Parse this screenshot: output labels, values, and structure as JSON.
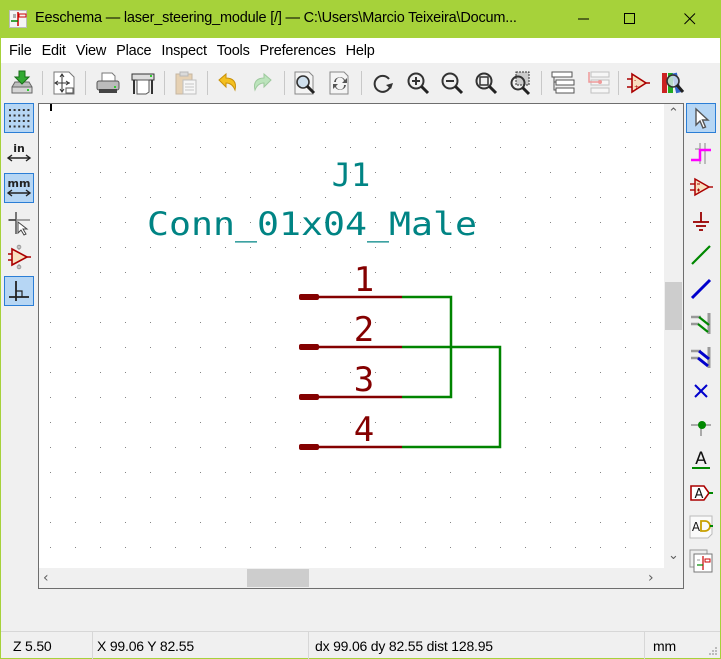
{
  "window": {
    "title": "Eeschema — laser_steering_module [/] — C:\\Users\\Marcio Teixeira\\Docum...",
    "controls": [
      "minimize",
      "maximize",
      "close"
    ],
    "accent_color": "#a6d23a"
  },
  "menu": {
    "items": [
      {
        "label": "File"
      },
      {
        "label": "Edit"
      },
      {
        "label": "View"
      },
      {
        "label": "Place"
      },
      {
        "label": "Inspect"
      },
      {
        "label": "Tools"
      },
      {
        "label": "Preferences"
      },
      {
        "label": "Help"
      }
    ]
  },
  "toolbar": {
    "items": [
      {
        "name": "save-icon",
        "tooltip": "Save"
      },
      {
        "name": "page-settings-icon",
        "tooltip": "Page settings"
      },
      {
        "name": "print-icon",
        "tooltip": "Print"
      },
      {
        "name": "plot-icon",
        "tooltip": "Plot"
      },
      {
        "name": "paste-icon",
        "tooltip": "Paste",
        "disabled": true
      },
      {
        "name": "undo-icon",
        "tooltip": "Undo"
      },
      {
        "name": "redo-icon",
        "tooltip": "Redo",
        "disabled": true
      },
      {
        "name": "find-icon",
        "tooltip": "Find"
      },
      {
        "name": "find-replace-icon",
        "tooltip": "Find and replace"
      },
      {
        "name": "redraw-icon",
        "tooltip": "Refresh"
      },
      {
        "name": "zoom-in-icon",
        "tooltip": "Zoom in"
      },
      {
        "name": "zoom-out-icon",
        "tooltip": "Zoom out"
      },
      {
        "name": "zoom-fit-icon",
        "tooltip": "Zoom to fit"
      },
      {
        "name": "zoom-selection-icon",
        "tooltip": "Zoom to selection"
      },
      {
        "name": "hierarchy-navigator-icon",
        "tooltip": "Hierarchy navigator"
      },
      {
        "name": "leave-sheet-icon",
        "tooltip": "Leave sheet",
        "disabled": true
      },
      {
        "name": "symbol-editor-icon",
        "tooltip": "Symbol editor"
      },
      {
        "name": "symbol-browser-icon",
        "tooltip": "Symbol library browser"
      }
    ]
  },
  "left_toolbar": {
    "items": [
      {
        "name": "grid-toggle-icon",
        "active": true
      },
      {
        "name": "units-inch-icon",
        "label": "in",
        "active": false
      },
      {
        "name": "units-mm-icon",
        "label": "mm",
        "active": true
      },
      {
        "name": "full-crosshair-icon",
        "active": false
      },
      {
        "name": "hidden-pins-icon",
        "active": false
      },
      {
        "name": "orthogonal-wire-icon",
        "active": true
      }
    ]
  },
  "right_toolbar": {
    "items": [
      {
        "name": "select-tool-icon",
        "active": true
      },
      {
        "name": "highlight-net-icon"
      },
      {
        "name": "add-symbol-icon"
      },
      {
        "name": "add-power-icon"
      },
      {
        "name": "add-wire-icon"
      },
      {
        "name": "add-bus-icon"
      },
      {
        "name": "add-wire-to-bus-entry-icon"
      },
      {
        "name": "add-bus-to-bus-entry-icon"
      },
      {
        "name": "add-no-connect-icon"
      },
      {
        "name": "add-junction-icon"
      },
      {
        "name": "add-label-icon",
        "label": "A"
      },
      {
        "name": "add-global-label-icon",
        "label": "A"
      },
      {
        "name": "add-hierarchical-label-icon",
        "label": "A"
      },
      {
        "name": "add-sheet-icon"
      }
    ]
  },
  "schematic": {
    "colors": {
      "reference": "#008484",
      "pin": "#840000",
      "wire": "#008400",
      "grid": "#848484"
    },
    "symbol": {
      "reference": "J1",
      "value": "Conn_01x04_Male",
      "pins": [
        {
          "number": "1"
        },
        {
          "number": "2"
        },
        {
          "number": "3"
        },
        {
          "number": "4"
        }
      ]
    },
    "wires": [
      {
        "from_pin": "1",
        "to_pin": "3"
      },
      {
        "from_pin": "2",
        "to_pin": "4"
      }
    ]
  },
  "scrollbars": {
    "vertical_position": 0.42,
    "horizontal_position": 0.36
  },
  "status": {
    "zoom": "Z 5.50",
    "cursor": "X 99.06  Y 82.55",
    "delta": "dx 99.06  dy 82.55  dist 128.95",
    "units": "mm"
  }
}
